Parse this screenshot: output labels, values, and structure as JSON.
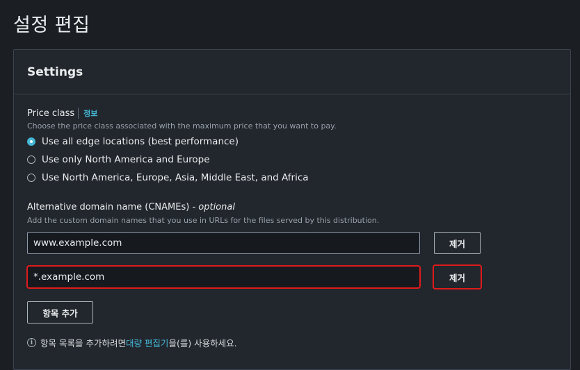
{
  "page": {
    "title": "설정 편집"
  },
  "settings": {
    "header": "Settings",
    "price_class": {
      "label": "Price class",
      "info": "정보",
      "description": "Choose the price class associated with the maximum price that you want to pay.",
      "options": [
        {
          "label": "Use all edge locations (best performance)",
          "selected": true
        },
        {
          "label": "Use only North America and Europe",
          "selected": false
        },
        {
          "label": "Use North America, Europe, Asia, Middle East, and Africa",
          "selected": false
        }
      ]
    },
    "cnames": {
      "label": "Alternative domain name (CNAMEs) - ",
      "optional": "optional",
      "description": "Add the custom domain names that you use in URLs for the files served by this distribution.",
      "items": [
        {
          "value": "www.example.com",
          "remove_label": "제거"
        },
        {
          "value": "*.example.com",
          "remove_label": "제거"
        }
      ],
      "add_item_label": "항목 추가",
      "hint_prefix": "항목 목록을 추가하려면 ",
      "hint_link": "대량 편집기",
      "hint_suffix": "을(를) 사용하세요."
    }
  },
  "colors": {
    "background": "#1b1e23",
    "panel": "#22262d",
    "accent": "#44b9d6",
    "highlight": "#e01b1b"
  },
  "icons": {
    "info": "info-circle-icon"
  }
}
